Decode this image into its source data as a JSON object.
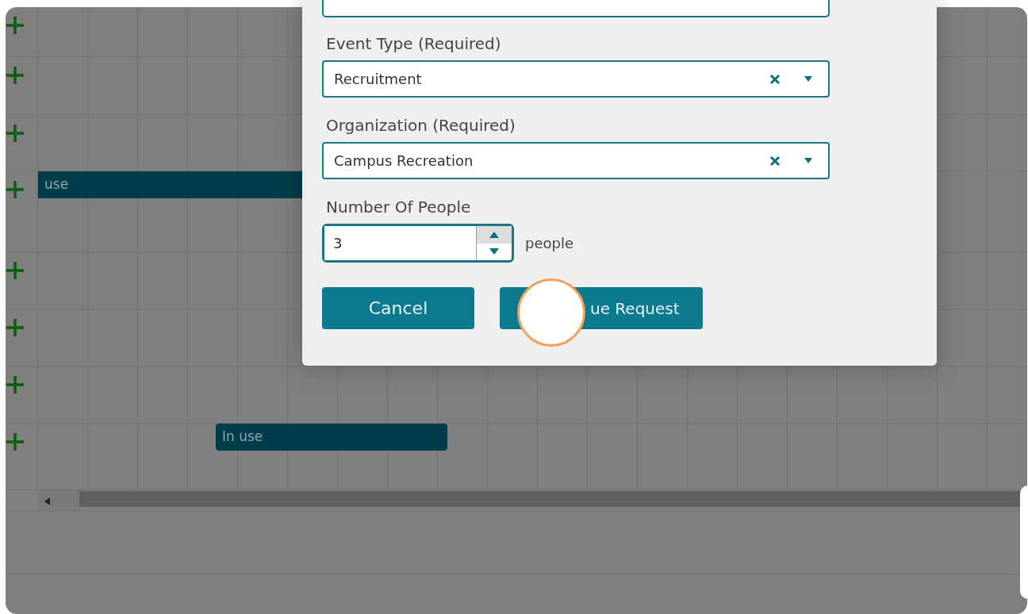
{
  "schedule": {
    "rows": [
      {
        "kind": "empty"
      },
      {
        "kind": "empty"
      },
      {
        "kind": "empty"
      },
      {
        "kind": "booked",
        "booking_label": "use"
      },
      {
        "kind": "empty"
      },
      {
        "kind": "empty"
      },
      {
        "kind": "empty"
      },
      {
        "kind": "booked",
        "booking_label": "In use"
      }
    ]
  },
  "dialog": {
    "fields": [
      {
        "kind": "select",
        "label": "Event Type (Required)",
        "value": "Recruitment"
      },
      {
        "kind": "select",
        "label": "Organization (Required)",
        "value": "Campus Recreation"
      },
      {
        "kind": "number",
        "label": "Number Of People",
        "value": "3",
        "unit": "people"
      }
    ],
    "buttons": [
      "Cancel",
      "ue Request"
    ]
  }
}
